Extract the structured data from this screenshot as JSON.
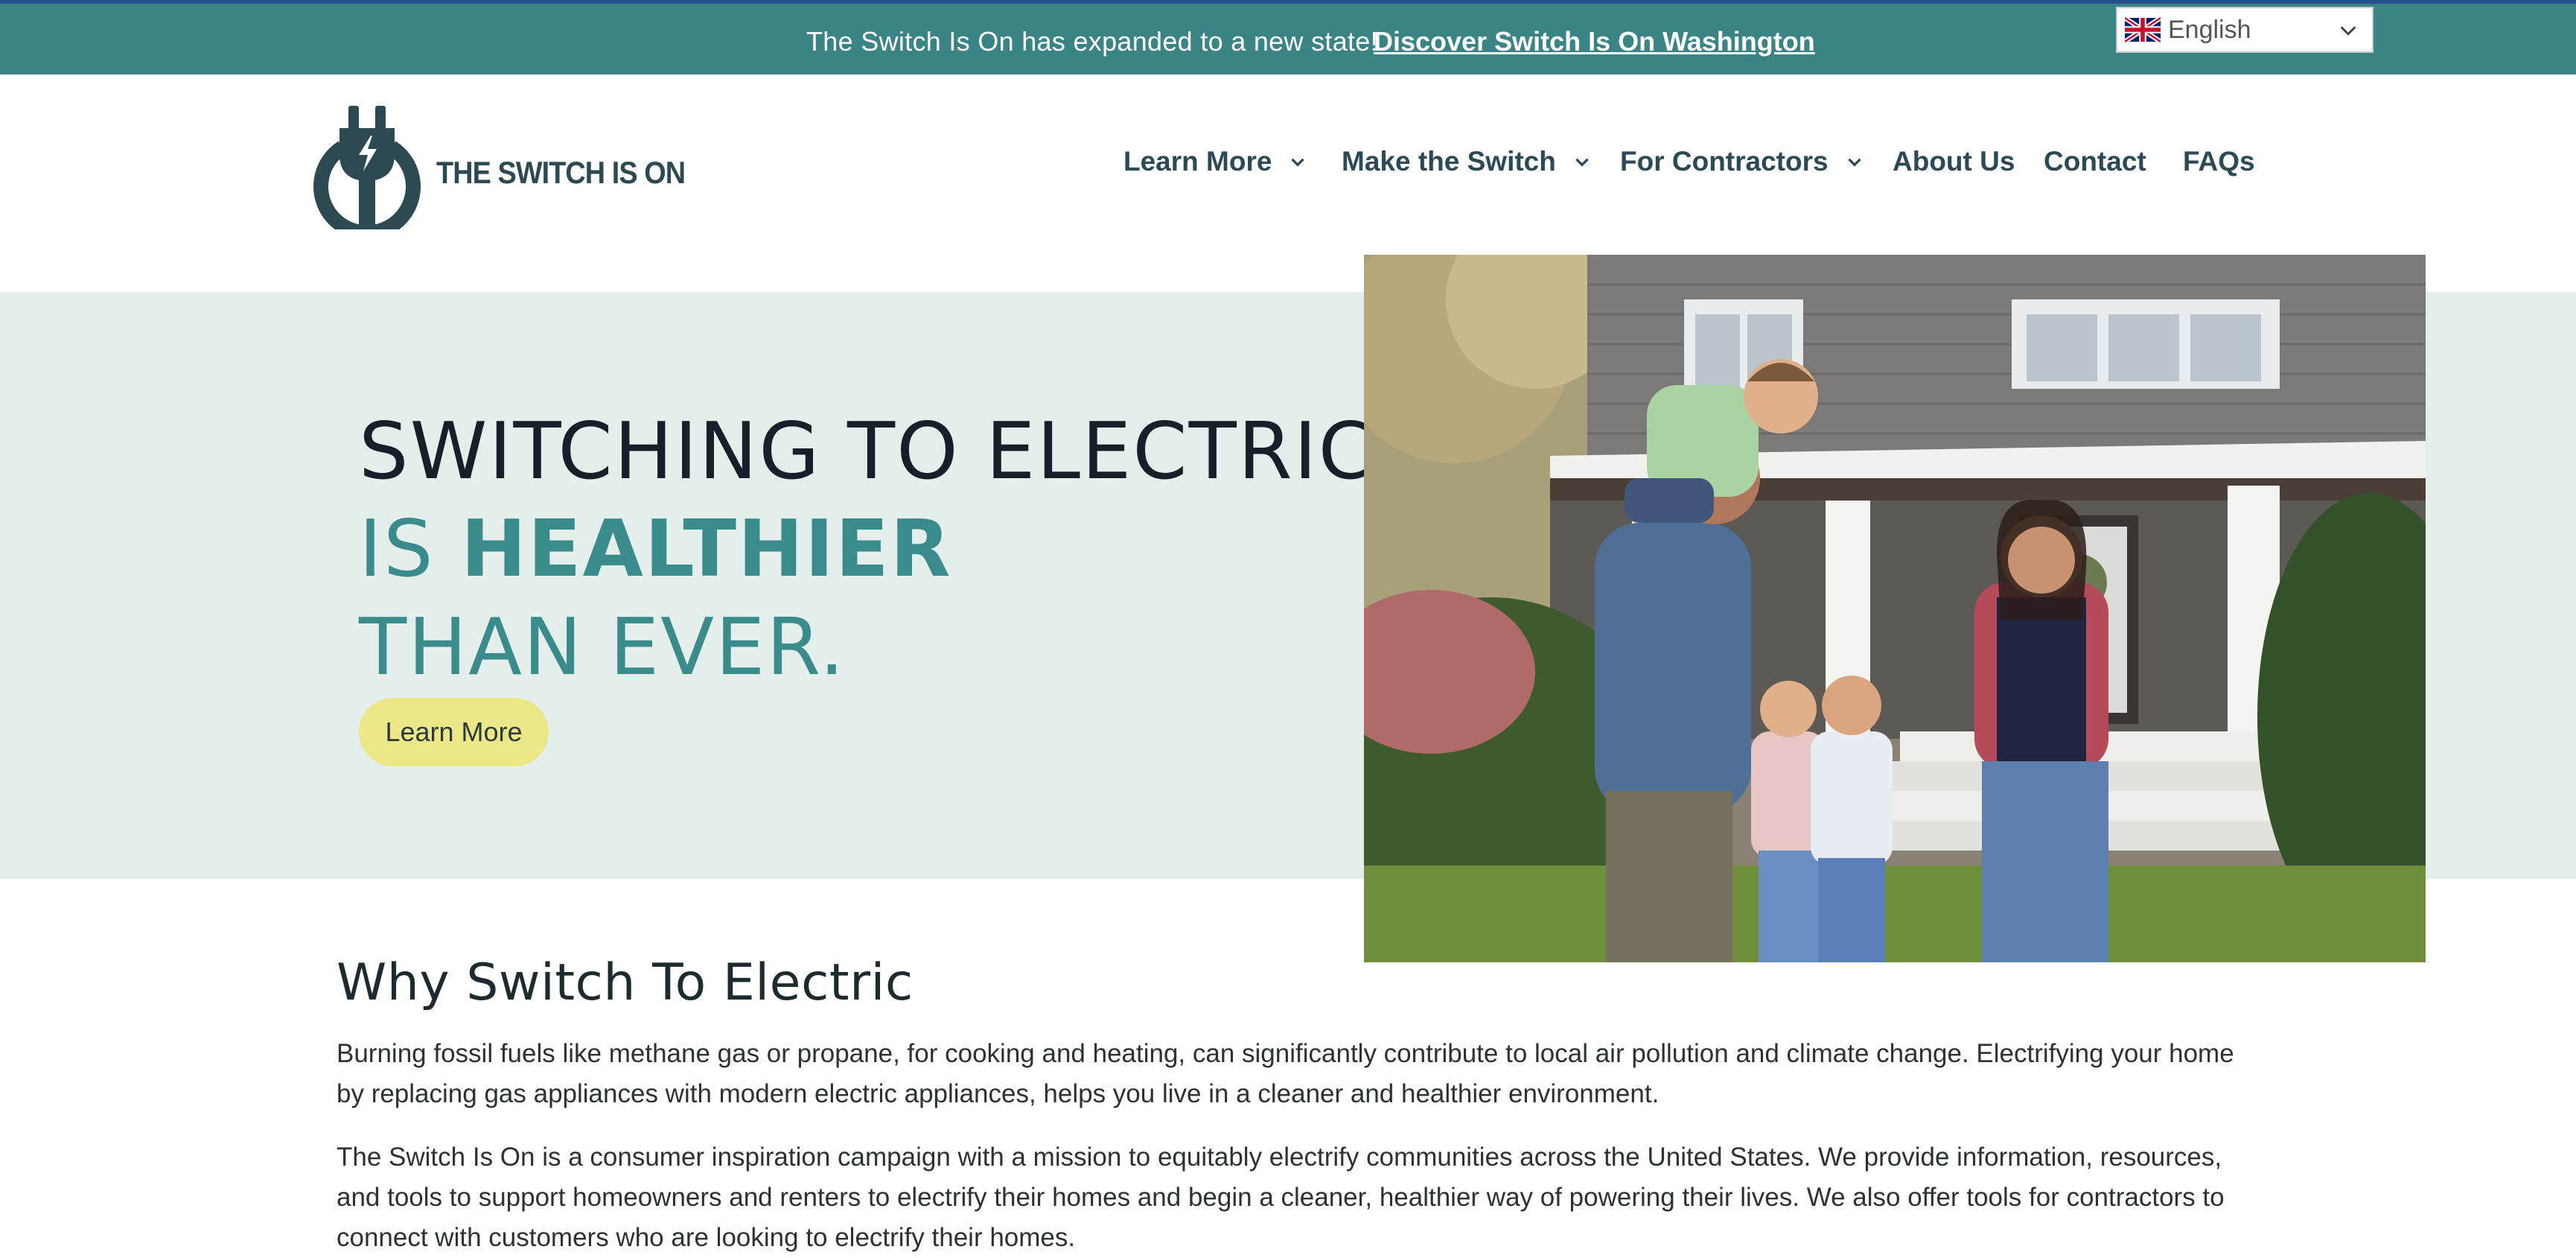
{
  "announcement": {
    "message": "The Switch Is On has expanded to a new state!",
    "link": "Discover Switch Is On Washington"
  },
  "language": {
    "selected": "English",
    "flag_icon": "uk-flag-icon"
  },
  "logo": {
    "text": "THE SWITCH IS ON",
    "icon": "electric-plug-icon"
  },
  "nav": {
    "items": [
      {
        "label": "Learn More",
        "has_dropdown": true
      },
      {
        "label": "Make the Switch",
        "has_dropdown": true
      },
      {
        "label": "For Contractors",
        "has_dropdown": true
      },
      {
        "label": "About Us",
        "has_dropdown": false
      },
      {
        "label": "Contact",
        "has_dropdown": false
      },
      {
        "label": "FAQs",
        "has_dropdown": false
      }
    ]
  },
  "hero": {
    "line1": "SWITCHING TO ELECTRIC",
    "line2_prefix": "IS ",
    "line2_strong": "HEALTHIER",
    "line3": "THAN EVER.",
    "button_label": "Learn More"
  },
  "why": {
    "heading": "Why Switch To Electric",
    "paragraph1": "Burning fossil fuels like methane gas or propane, for cooking and heating, can significantly contribute to local air pollution and climate change. Electrifying your home by replacing gas appliances with modern electric appliances, helps you live in a cleaner and healthier environment.",
    "paragraph2": "The Switch Is On is a consumer inspiration campaign with a mission to equitably electrify communities across the United States. We provide information, resources, and tools to support homeowners and renters to electrify their homes and begin a cleaner, healthier way of powering their lives. We also offer tools for contractors to connect with customers who are looking to electrify their homes."
  },
  "colors": {
    "topbar": "#3a8486",
    "hero_bg": "#e4eeea",
    "accent_teal": "#3a8b8c",
    "button_yellow": "#ece887",
    "nav_text": "#2b4a55"
  }
}
